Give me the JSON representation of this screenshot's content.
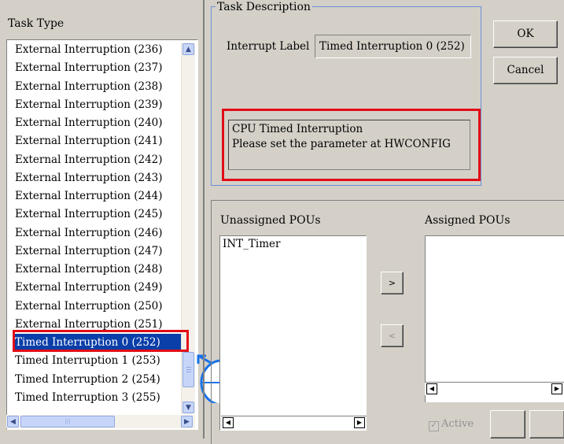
{
  "left": {
    "header": "Task Type",
    "items": [
      "External Interruption (236)",
      "External Interruption (237)",
      "External Interruption (238)",
      "External Interruption (239)",
      "External Interruption (240)",
      "External Interruption (241)",
      "External Interruption (242)",
      "External Interruption (243)",
      "External Interruption (244)",
      "External Interruption (245)",
      "External Interruption (246)",
      "External Interruption (247)",
      "External Interruption (248)",
      "External Interruption (249)",
      "External Interruption (250)",
      "External Interruption (251)",
      "Timed Interruption 0 (252)",
      "Timed Interruption 1 (253)",
      "Timed Interruption 2 (254)",
      "Timed Interruption 3 (255)"
    ],
    "selected_index": 16,
    "scroll_up_icon": "chevron-up-icon",
    "scroll_down_icon": "chevron-down-icon",
    "scroll_left_icon": "chevron-left-icon",
    "scroll_right_icon": "chevron-right-icon"
  },
  "task_description": {
    "title": "Task Description",
    "interrupt_label": "Interrupt Label",
    "interrupt_value": "Timed Interruption 0 (252)",
    "description_line1": "CPU Timed Interruption",
    "description_line2": "Please set the parameter at HWCONFIG"
  },
  "buttons": {
    "ok": "OK",
    "cancel": "Cancel",
    "move_right": ">",
    "move_left": "<"
  },
  "pou": {
    "unassigned_header": "Unassigned POUs",
    "assigned_header": "Assigned POUs",
    "unassigned_items": [
      "INT_Timer"
    ],
    "active_label": "Active"
  },
  "colors": {
    "selection": "#0a3ea8",
    "highlight_red": "#e10d16",
    "annotation_blue": "#1a73e8"
  }
}
